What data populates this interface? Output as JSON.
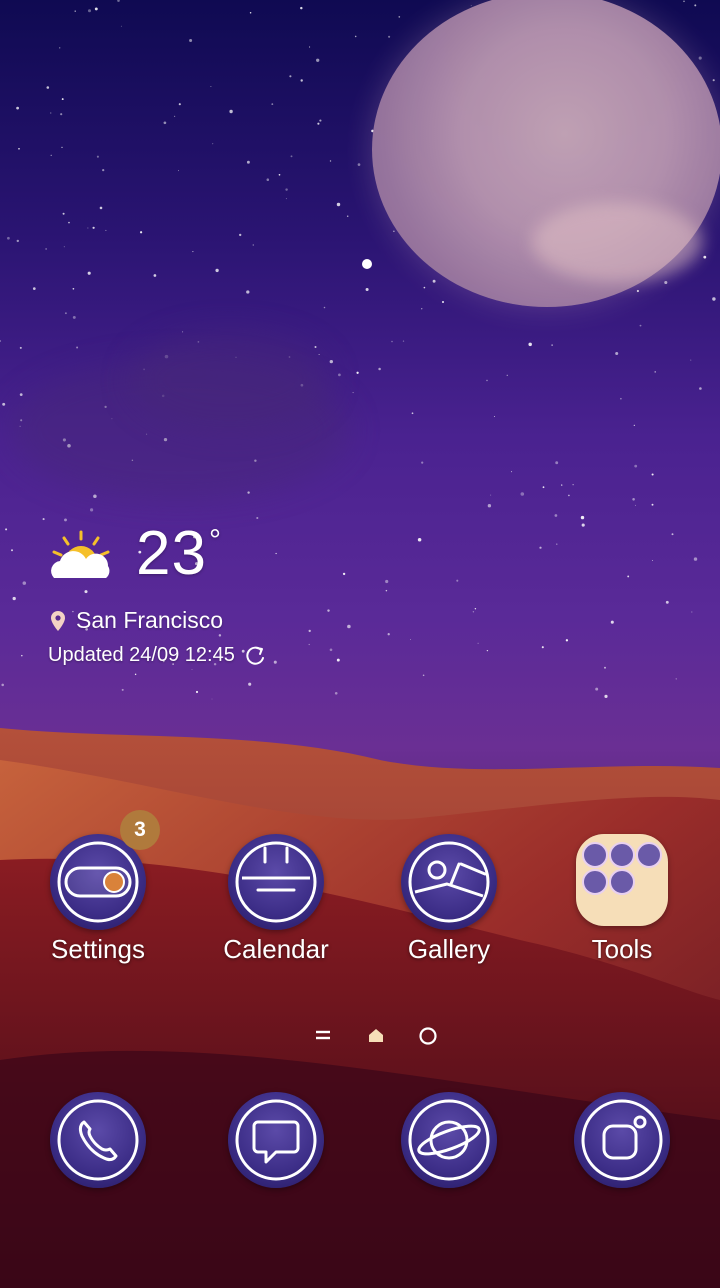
{
  "weather": {
    "temperature": "23",
    "degree_symbol": "°",
    "location": "San Francisco",
    "updated": "Updated 24/09 12:45",
    "icon": "partly-sunny-icon"
  },
  "apps": [
    {
      "label": "Settings",
      "icon": "settings-toggle-icon",
      "badge": "3"
    },
    {
      "label": "Calendar",
      "icon": "calendar-icon"
    },
    {
      "label": "Gallery",
      "icon": "gallery-icon"
    },
    {
      "label": "Tools",
      "icon": "folder-icon"
    }
  ],
  "dock": [
    {
      "icon": "phone-icon"
    },
    {
      "icon": "message-icon"
    },
    {
      "icon": "internet-planet-icon"
    },
    {
      "icon": "camera-icon"
    }
  ],
  "page_indicators": [
    "menu-page-indicator",
    "home-page-indicator",
    "page-dot-indicator"
  ],
  "colors": {
    "badge": "#b07a3c",
    "icon_outline": "#ffffff",
    "folder_bg": "#f6deb8"
  }
}
